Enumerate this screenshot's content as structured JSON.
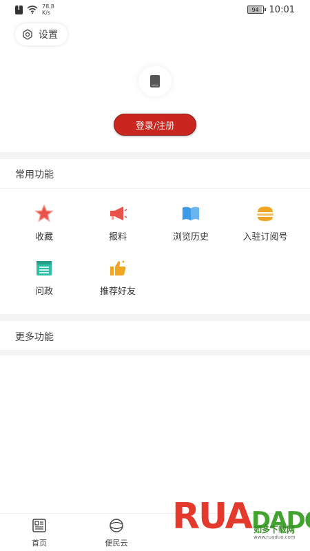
{
  "status_bar": {
    "speed_value": "78.8",
    "speed_unit": "K/s",
    "battery": "94",
    "time": "10:01"
  },
  "settings": {
    "label": "设置",
    "icon": "gear-icon"
  },
  "avatar": {
    "icon": "phone-icon"
  },
  "login": {
    "label": "登录/注册"
  },
  "common_section": {
    "title": "常用功能",
    "items": [
      {
        "label": "收藏",
        "icon": "star-icon",
        "color": "#e8524a"
      },
      {
        "label": "报料",
        "icon": "megaphone-icon",
        "color": "#e8524a"
      },
      {
        "label": "浏览历史",
        "icon": "book-icon",
        "color": "#3d9ae8"
      },
      {
        "label": "入驻订阅号",
        "icon": "burger-icon",
        "color": "#f0a623"
      },
      {
        "label": "问政",
        "icon": "calendar-icon",
        "color": "#2fbfa6"
      },
      {
        "label": "推荐好友",
        "icon": "thumbs-up-icon",
        "color": "#f0a623"
      }
    ]
  },
  "more_section": {
    "title": "更多功能"
  },
  "bottom_nav": {
    "items": [
      {
        "label": "首页",
        "icon": "news-icon"
      },
      {
        "label": "便民云",
        "icon": "cloud-icon"
      }
    ]
  },
  "watermark": {
    "letters": [
      "R",
      "U",
      "A",
      "D",
      "A",
      "D",
      "O"
    ],
    "cn_text": "如多下载网",
    "url": "www.ruaduo.com"
  }
}
